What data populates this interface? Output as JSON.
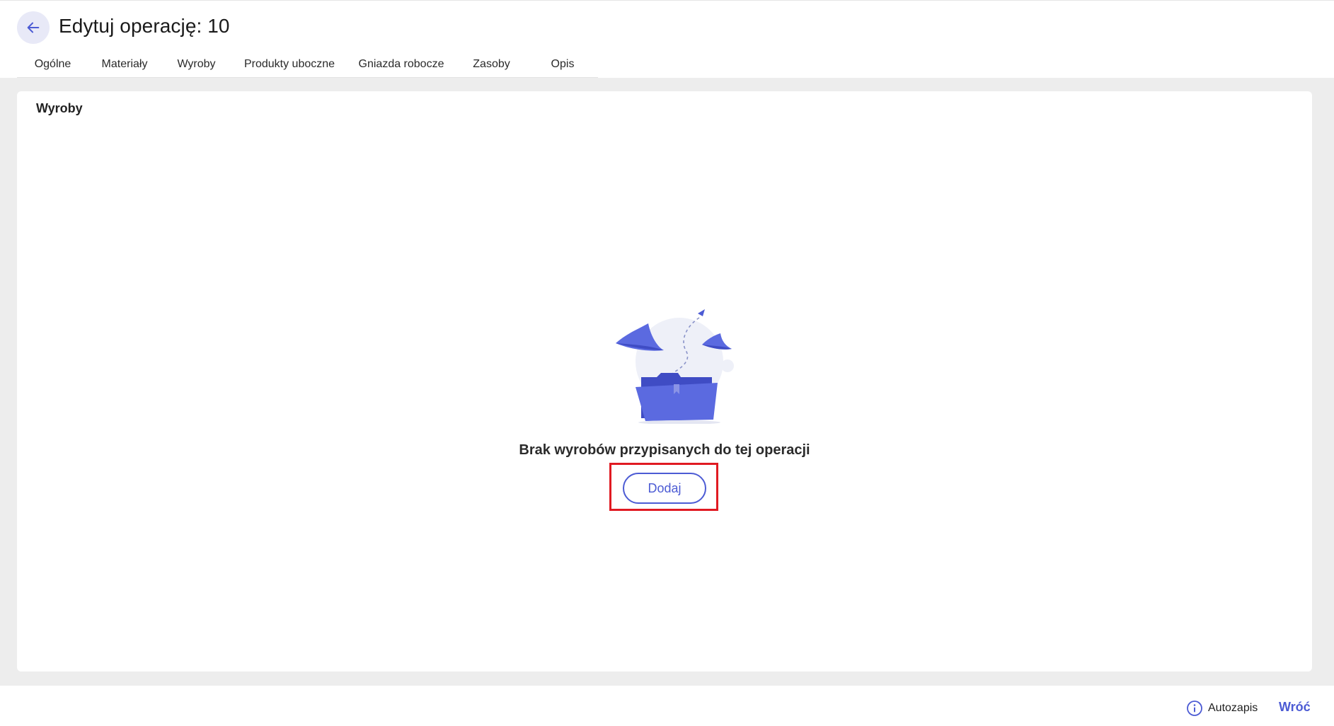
{
  "header": {
    "title": "Edytuj operację: 10",
    "back_icon": "arrow-left-icon"
  },
  "tabs": [
    {
      "label": "Ogólne",
      "active": false
    },
    {
      "label": "Materiały",
      "active": false
    },
    {
      "label": "Wyroby",
      "active": true
    },
    {
      "label": "Produkty uboczne",
      "active": false
    },
    {
      "label": "Gniazda robocze",
      "active": false
    },
    {
      "label": "Zasoby",
      "active": false
    },
    {
      "label": "Opis",
      "active": false
    }
  ],
  "panel": {
    "title": "Wyroby",
    "empty_message": "Brak wyrobów przypisanych do tej operacji",
    "add_label": "Dodaj",
    "illustration_icon": "empty-folder-illustration"
  },
  "footer": {
    "autosave_label": "Autozapis",
    "autosave_icon": "info-icon",
    "back_label": "Wróć"
  },
  "colors": {
    "accent": "#4c5bd4",
    "highlight": "#e01a22",
    "background": "#ededed"
  }
}
